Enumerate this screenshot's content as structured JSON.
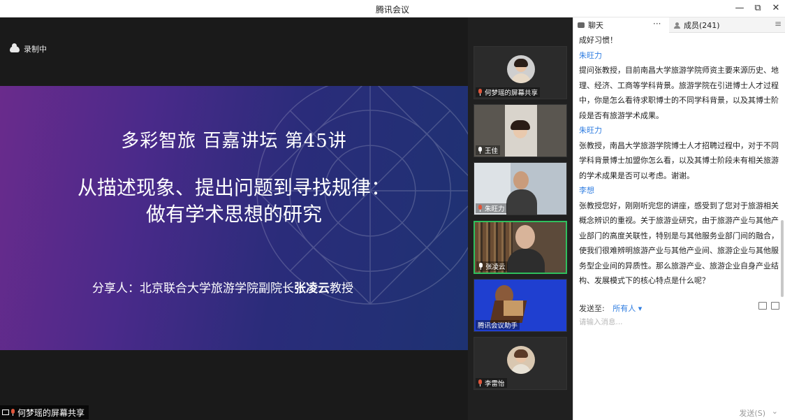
{
  "window": {
    "title": "腾讯会议",
    "minimize": "—",
    "restore": "⧉",
    "close": "✕"
  },
  "recording": {
    "label": "录制中"
  },
  "slide": {
    "line1": "多彩智旅 百嘉讲坛 第45讲",
    "line2": "从描述现象、提出问题到寻找规律：",
    "line3": "做有学术思想的研究",
    "speaker_prefix": "分享人：北京联合大学旅游学院副院长",
    "speaker_name": "张凌云",
    "speaker_suffix": "教授"
  },
  "screen_share_label": "何梦瑶的屏幕共享",
  "participants": [
    {
      "name": "何梦瑶的屏幕共享",
      "muted": true
    },
    {
      "name": "王佳",
      "muted": false
    },
    {
      "name": "朱旺力",
      "muted": true
    },
    {
      "name": "张凌云",
      "muted": false,
      "speaking": true
    },
    {
      "name": "腾讯会议助手",
      "muted": false
    },
    {
      "name": "李雷怡",
      "muted": true
    }
  ],
  "chat": {
    "tab_chat": "聊天",
    "tab_more": "···",
    "tab_members": "成员(241)",
    "tab_menu": "≡",
    "partial_top": "成好习惯！",
    "messages": [
      {
        "sender": "朱旺力",
        "text": "提问张教授，目前南昌大学旅游学院师资主要来源历史、地理、经济、工商等学科背景。旅游学院在引进博士人才过程中，你是怎么看待求职博士的不同学科背景，以及其博士阶段是否有旅游学术成果。"
      },
      {
        "sender": "朱旺力",
        "text": "张教授，南昌大学旅游学院博士人才招聘过程中，对于不同学科背景博士加盟你怎么看，以及其博士阶段未有相关旅游的学术成果是否可以考虑。谢谢。"
      },
      {
        "sender": "李想",
        "text": "张教授您好，刚刚听完您的讲座，感受到了您对于旅游相关概念辨识的重视。关于旅游业研究，由于旅游产业与其他产业部门的高度关联性，特别是与其他服务业部门间的融合，使我们很难辨明旅游产业与其他产业间、旅游企业与其他服务型企业间的异质性。那么旅游产业、旅游企业自身产业结构、发展模式下的核心特点是什么呢？"
      }
    ],
    "send_to_label": "发送至:",
    "send_to_value": "所有人 ▾",
    "input_placeholder": "请输入消息...",
    "send_button": "发送(S)",
    "send_arrow": "⌄"
  }
}
